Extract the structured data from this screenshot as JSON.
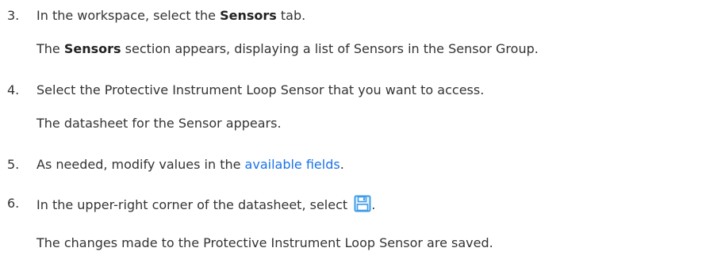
{
  "steps": [
    {
      "number": "3.",
      "before": "In the workspace, select the ",
      "bold": "Sensors",
      "after": " tab.",
      "result_bold": "Sensors",
      "result_after": " section appears, displaying a list of Sensors in the Sensor Group.",
      "result_before": "The "
    },
    {
      "number": "4.",
      "text": "Select the Protective Instrument Loop Sensor that you want to access.",
      "result": "The datasheet for the Sensor appears."
    },
    {
      "number": "5.",
      "before": "As needed, modify values in the ",
      "link": "available fields",
      "after": "."
    },
    {
      "number": "6.",
      "before": "In the upper-right corner of the datasheet, select ",
      "after": ".",
      "icon": "save-icon",
      "result": "The changes made to the Protective Instrument Loop Sensor are saved."
    }
  ],
  "colors": {
    "text": "#333333",
    "link": "#1a73e8",
    "icon": "#3d9be9"
  }
}
